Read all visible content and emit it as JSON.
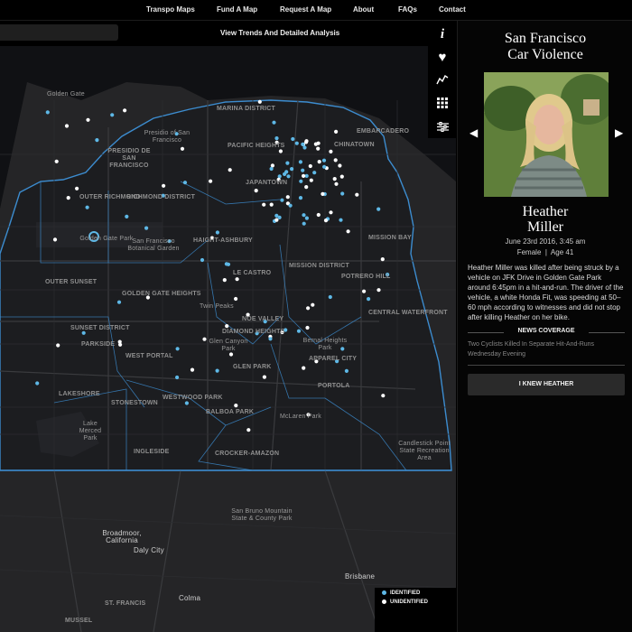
{
  "nav": {
    "items": [
      "Transpo Maps",
      "Fund A Map",
      "Request A Map",
      "About",
      "FAQs",
      "Contact"
    ]
  },
  "toolbar": {
    "trends_link": "View Trends And Detailed Analysis"
  },
  "side_icons": [
    "info-icon",
    "heart-icon",
    "trend-line-icon",
    "grid-icon",
    "sliders-icon"
  ],
  "legend": {
    "identified": "IDENTIFIED",
    "unidentified": "UNIDENTIFIED",
    "identified_color": "#5eb8e6",
    "unidentified_color": "#ffffff"
  },
  "map_labels": {
    "districts": [
      "MARINA DISTRICT",
      "EMBARCADERO",
      "PACIFIC HEIGHTS",
      "CHINATOWN",
      "OUTER RICHMOND",
      "RICHMOND DISTRICT",
      "JAPANTOWN",
      "MISSION BAY",
      "HAIGHT-ASHBURY",
      "MISSION DISTRICT",
      "LE CASTRO",
      "POTRERO HILL",
      "OUTER SUNSET",
      "GOLDEN GATE HEIGHTS",
      "SUNSET DISTRICT",
      "PARKSIDE",
      "NOE VALLEY",
      "DIAMOND HEIGHTS",
      "CENTRAL WATERFRONT",
      "WEST PORTAL",
      "GLEN PARK",
      "APPAREL CITY",
      "LAKESHORE",
      "STONESTOWN",
      "WESTWOOD PARK",
      "BALBOA PARK",
      "PORTOLA",
      "INGLESIDE",
      "CROCKER-AMAZON",
      "PRESIDIO DE SAN FRANCISCO",
      "ST. FRANCIS",
      "MUSSEL"
    ],
    "places": [
      "Golden Gate",
      "Presidio of San Francisco",
      "Golden Gate Park",
      "San Francisco Botanical Garden",
      "Twin Peaks",
      "Glen Canyon Park",
      "Bernal Heights Park",
      "McLaren Park",
      "Lake Merced Park",
      "Candlestick Point State Recreation Area",
      "San Bruno Mountain State & County Park"
    ],
    "cities": [
      "Broadmoor, California",
      "Daly City",
      "Brisbane",
      "Colma"
    ]
  },
  "profile": {
    "title_line1": "San Francisco",
    "title_line2": "Car Violence",
    "first_name": "Heather",
    "last_name": "Miller",
    "date": "June 23rd 2016, 3:45 am",
    "meta": "Female  |  Age 41",
    "description": "Heather Miller was killed after being struck by a vehicle on JFK Drive in Golden Gate Park around 6:45pm in a hit-and-run. The driver of the vehicle, a white Honda Fit, was speeding at 50–60 mph according to witnesses and did not stop after killing Heather on her bike.",
    "news_heading": "NEWS COVERAGE",
    "news_link": "Two Cyclists Killed In Separate Hit-And-Runs Wednesday Evening",
    "button": "I KNEW HEATHER",
    "prev": "‹",
    "next": "›"
  }
}
